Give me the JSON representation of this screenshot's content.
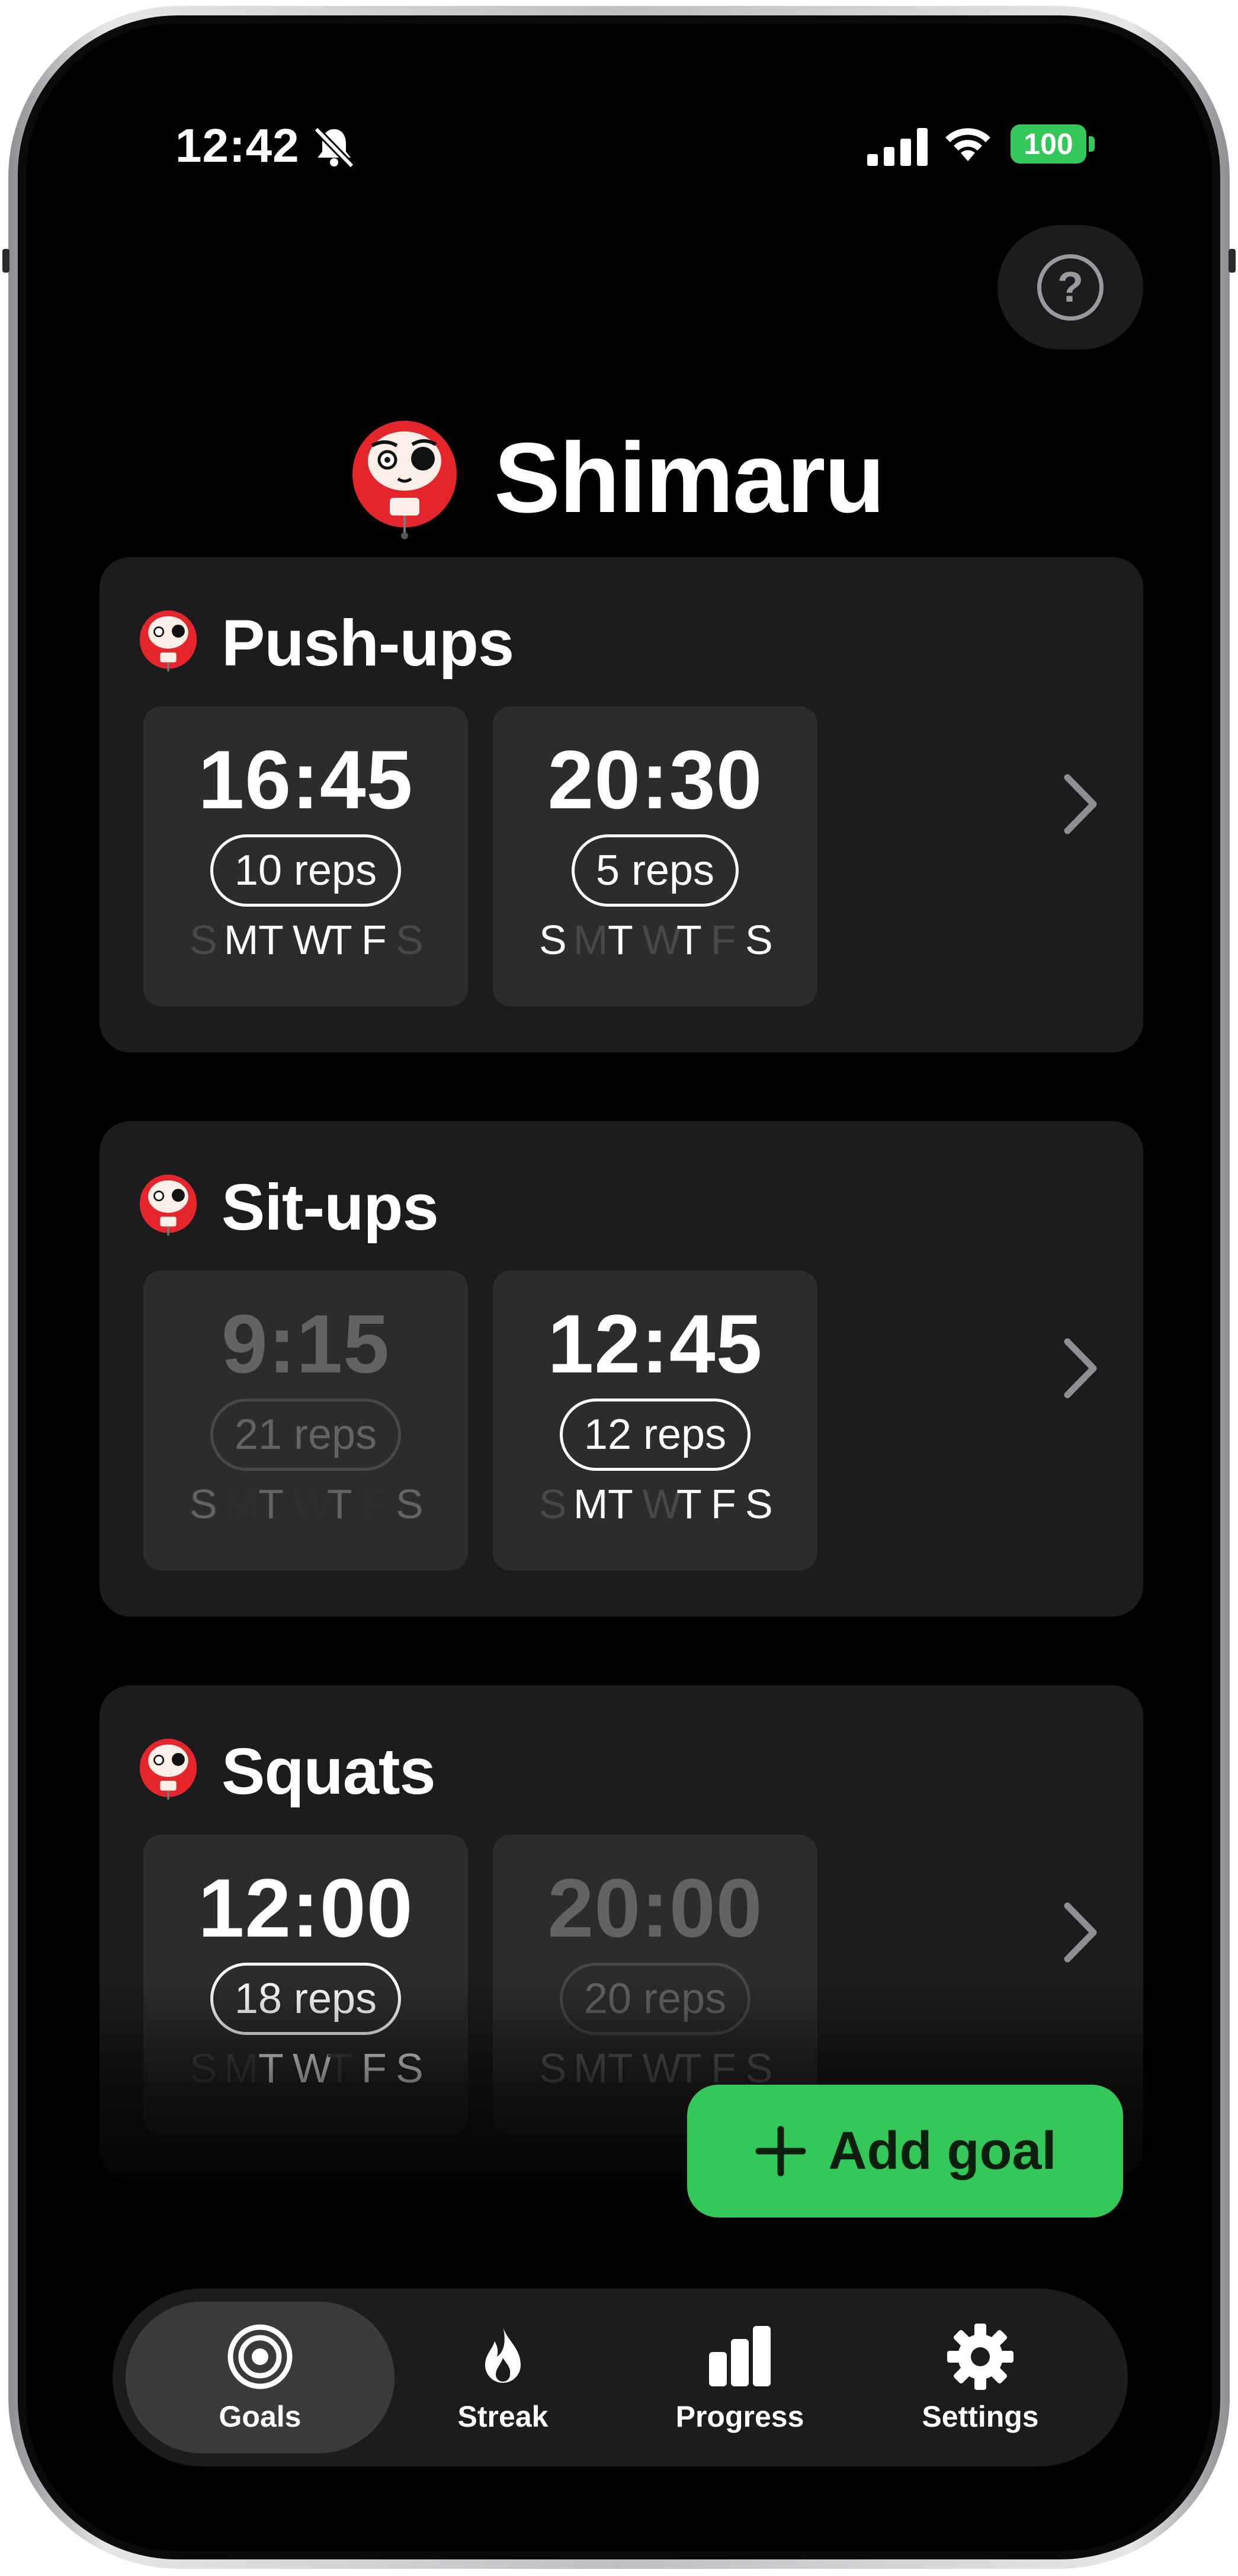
{
  "status_bar": {
    "time": "12:42",
    "battery": "100"
  },
  "header": {
    "help_label": "?",
    "title": "Shimaru"
  },
  "goals": [
    {
      "name": "Push-ups",
      "slots": [
        {
          "time": "16:45",
          "reps": "10 reps",
          "enabled": true,
          "days": [
            "S",
            "M",
            "T",
            "W",
            "T",
            "F",
            "S"
          ],
          "active_days": [
            false,
            true,
            true,
            true,
            true,
            true,
            false
          ]
        },
        {
          "time": "20:30",
          "reps": "5 reps",
          "enabled": true,
          "days": [
            "S",
            "M",
            "T",
            "W",
            "T",
            "F",
            "S"
          ],
          "active_days": [
            true,
            false,
            true,
            false,
            true,
            false,
            true
          ]
        }
      ]
    },
    {
      "name": "Sit-ups",
      "slots": [
        {
          "time": "9:15",
          "reps": "21 reps",
          "enabled": false,
          "days": [
            "S",
            "M",
            "T",
            "W",
            "T",
            "F",
            "S"
          ],
          "active_days": [
            true,
            false,
            true,
            false,
            true,
            false,
            true
          ]
        },
        {
          "time": "12:45",
          "reps": "12 reps",
          "enabled": true,
          "days": [
            "S",
            "M",
            "T",
            "W",
            "T",
            "F",
            "S"
          ],
          "active_days": [
            false,
            true,
            true,
            false,
            true,
            true,
            true
          ]
        }
      ]
    },
    {
      "name": "Squats",
      "slots": [
        {
          "time": "12:00",
          "reps": "18 reps",
          "enabled": true,
          "days": [
            "S",
            "M",
            "T",
            "W",
            "T",
            "F",
            "S"
          ],
          "active_days": [
            false,
            false,
            true,
            true,
            false,
            true,
            true
          ]
        },
        {
          "time": "20:00",
          "reps": "20 reps",
          "enabled": false,
          "days": [
            "S",
            "M",
            "T",
            "W",
            "T",
            "F",
            "S"
          ],
          "active_days": [
            true,
            true,
            true,
            true,
            true,
            true,
            true
          ]
        }
      ]
    }
  ],
  "add_goal": {
    "label": "Add goal"
  },
  "tab_bar": {
    "tabs": [
      {
        "label": "Goals",
        "icon": "target-icon",
        "active": true
      },
      {
        "label": "Streak",
        "icon": "flame-icon",
        "active": false
      },
      {
        "label": "Progress",
        "icon": "bar-chart-icon",
        "active": false
      },
      {
        "label": "Settings",
        "icon": "gear-icon",
        "active": false
      }
    ]
  },
  "colors": {
    "accent_green": "#34c759",
    "card_bg": "#1c1c1e",
    "slot_bg": "#2c2c2e",
    "logo_red": "#e4262c"
  }
}
